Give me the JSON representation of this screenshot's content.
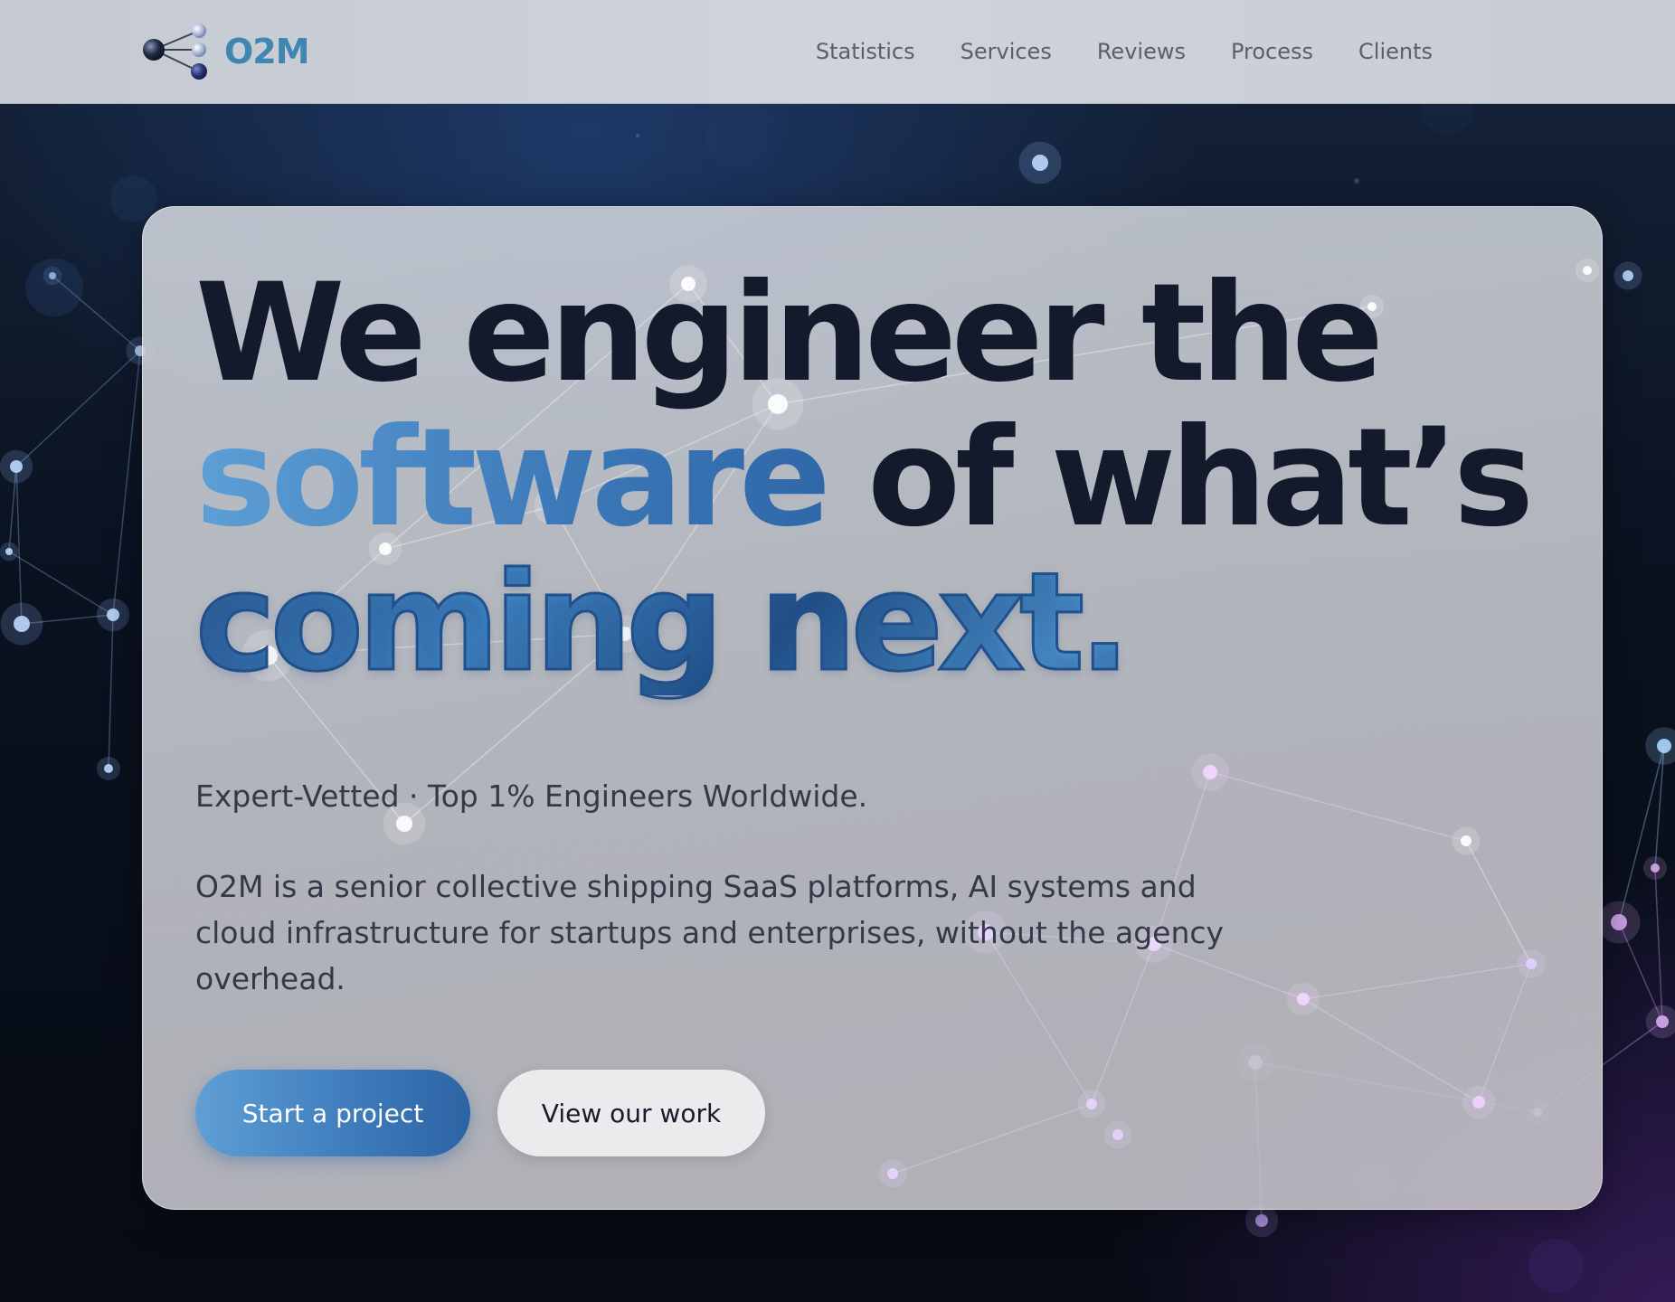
{
  "brand": {
    "name": "O2M",
    "color": "#3f86b0"
  },
  "nav": {
    "links": [
      "Statistics",
      "Services",
      "Reviews",
      "Process",
      "Clients"
    ]
  },
  "hero": {
    "headline_line1": "We engineer the",
    "headline_accent": "software",
    "headline_line2_rest": "of what’s",
    "headline_line3": "coming next.",
    "tagline": "Expert-Vetted · Top 1% Engineers Worldwide.",
    "description": "O2M is a senior collective shipping SaaS platforms, AI systems and cloud infrastructure for startups and enterprises, without the agency overhead.",
    "primary_cta": "Start a project",
    "secondary_cta": "View our work"
  },
  "colors": {
    "headline": "#121a2c",
    "accent": "#3b78b8",
    "primary_button": "#3f7dbe",
    "secondary_button": "#ebebed"
  },
  "icons": {
    "logo": "molecule-logo-icon",
    "background": "network-constellation"
  }
}
